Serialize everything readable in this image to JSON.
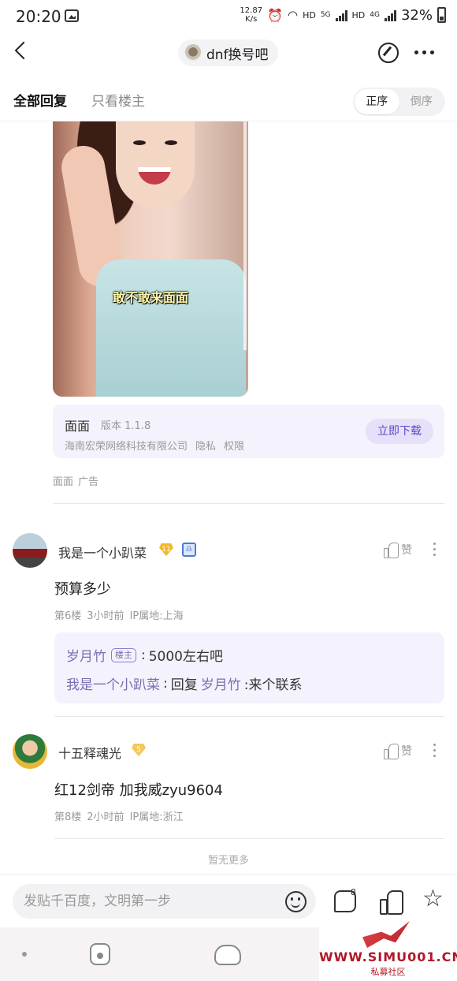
{
  "status": {
    "time": "20:20",
    "speed_top": "12.87",
    "speed_bottom": "K/s",
    "hd1": "HD",
    "net1": "5G",
    "hd2": "HD",
    "net2": "4G",
    "battery": "32%"
  },
  "nav": {
    "forum_name": "dnf换号吧"
  },
  "tabs": {
    "all_replies": "全部回复",
    "op_only": "只看楼主",
    "sort_asc": "正序",
    "sort_desc": "倒序"
  },
  "ad": {
    "caption": "敢不敢来面面",
    "app_name": "面面",
    "version": "版本 1.1.8",
    "company": "海南宏荣网络科技有限公司",
    "privacy": "隐私",
    "permissions": "权限",
    "download": "立即下载",
    "source": "面面",
    "ad_label": "广告"
  },
  "comments": [
    {
      "username": "我是一个小趴菜",
      "level": "11",
      "like_label": "赞",
      "text": "预算多少",
      "floor": "第6楼",
      "time": "3小时前",
      "ip": "IP属地:上海",
      "replies": [
        {
          "name": "岁月竹",
          "host_tag": "楼主",
          "sep": ":",
          "text": "5000左右吧"
        },
        {
          "name": "我是一个小趴菜",
          "sep": ":",
          "prefix": "回复",
          "target": "岁月竹",
          "text": ":来个联系"
        }
      ]
    },
    {
      "username": "十五释魂光",
      "level": "5",
      "like_label": "赞",
      "text": "红12剑帝 加我威zyu9604",
      "floor": "第8楼",
      "time": "2小时前",
      "ip": "IP属地:浙江"
    }
  ],
  "footer": {
    "no_more": "暂无更多"
  },
  "bottom": {
    "placeholder": "发贴千百度，文明第一步",
    "comment_count": "8"
  },
  "watermark": {
    "site": "WWW.SIMU001.CN",
    "sub": "私募社区"
  },
  "colors": {
    "accent": "#5d48c9",
    "card_bg": "#f4f2fc",
    "level_gold": "#f2b92a"
  }
}
